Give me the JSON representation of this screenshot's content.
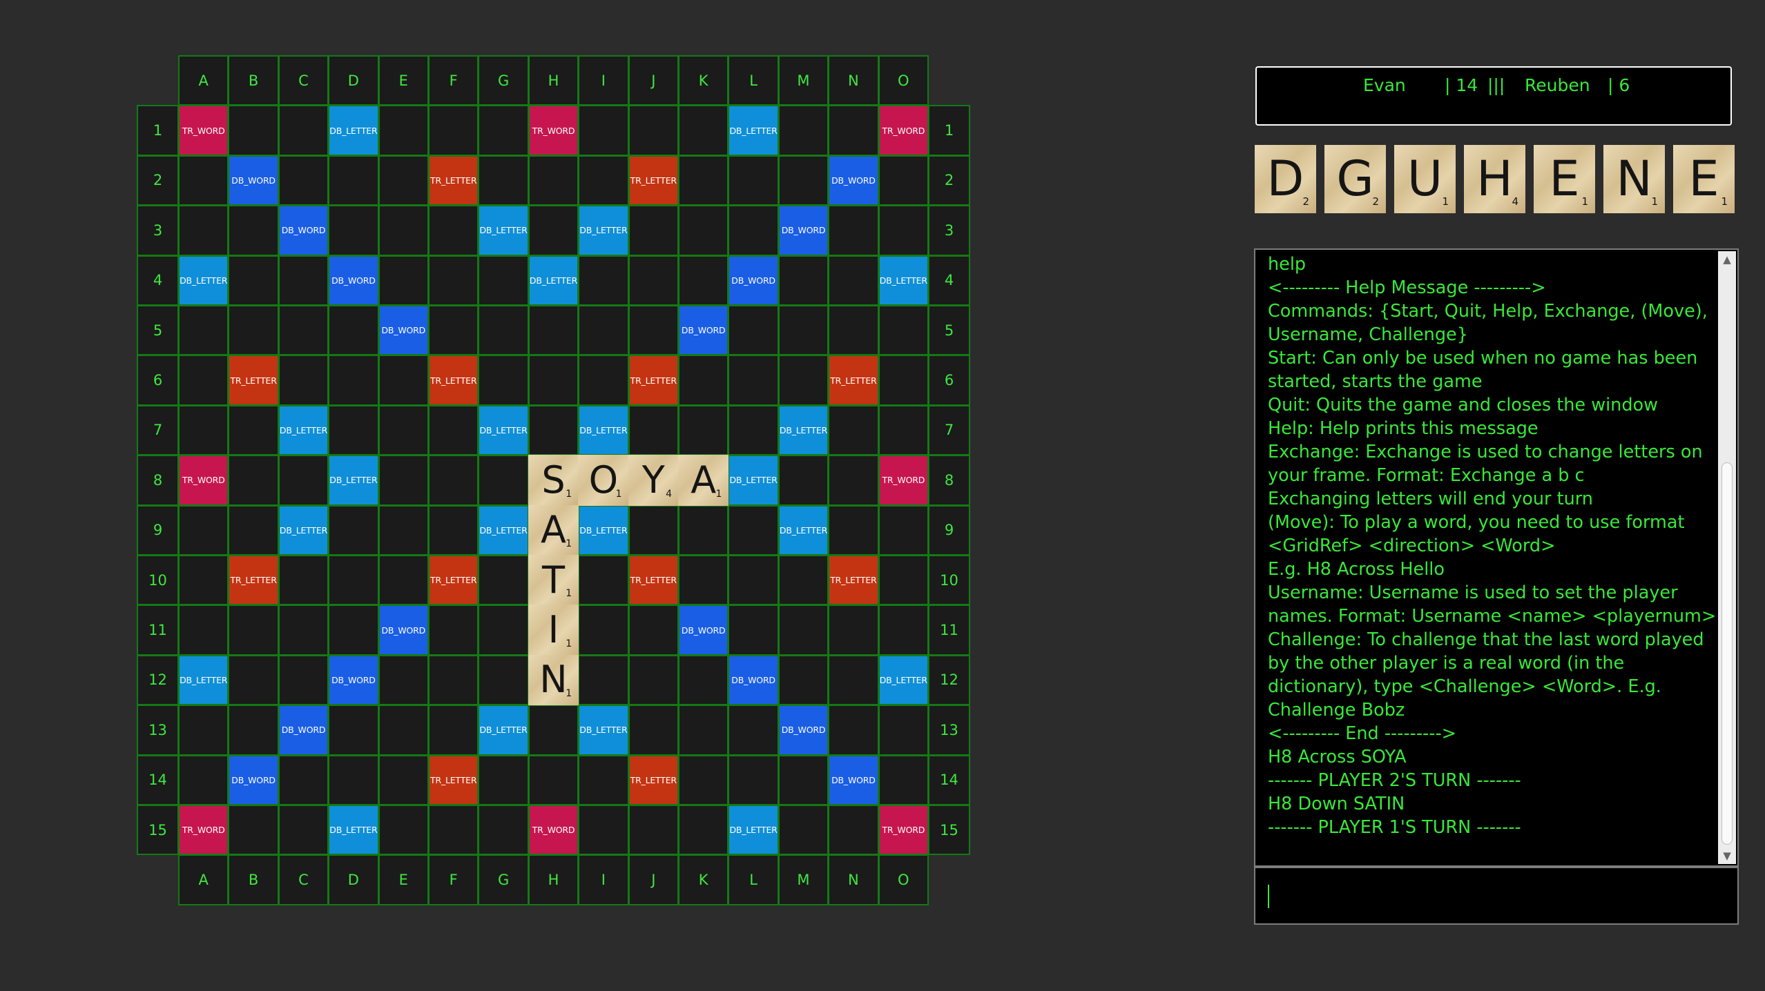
{
  "board": {
    "columns": [
      "A",
      "B",
      "C",
      "D",
      "E",
      "F",
      "G",
      "H",
      "I",
      "J",
      "K",
      "L",
      "M",
      "N",
      "O"
    ],
    "rows": [
      "1",
      "2",
      "3",
      "4",
      "5",
      "6",
      "7",
      "8",
      "9",
      "10",
      "11",
      "12",
      "13",
      "14",
      "15"
    ],
    "colors": {
      "TR_WORD": "#c7164f",
      "DB_WORD": "#1a5ee6",
      "DB_LETTER": "#0f8fd9",
      "TR_LETTER": "#c53412"
    },
    "premium_rows": [
      [
        "TR_WORD",
        "",
        "",
        "DB_LETTER",
        "",
        "",
        "",
        "TR_WORD",
        "",
        "",
        "",
        "DB_LETTER",
        "",
        "",
        "TR_WORD"
      ],
      [
        "",
        "DB_WORD",
        "",
        "",
        "",
        "TR_LETTER",
        "",
        "",
        "",
        "TR_LETTER",
        "",
        "",
        "",
        "DB_WORD",
        ""
      ],
      [
        "",
        "",
        "DB_WORD",
        "",
        "",
        "",
        "DB_LETTER",
        "",
        "DB_LETTER",
        "",
        "",
        "",
        "DB_WORD",
        "",
        ""
      ],
      [
        "DB_LETTER",
        "",
        "",
        "DB_WORD",
        "",
        "",
        "",
        "DB_LETTER",
        "",
        "",
        "",
        "DB_WORD",
        "",
        "",
        "DB_LETTER"
      ],
      [
        "",
        "",
        "",
        "",
        "DB_WORD",
        "",
        "",
        "",
        "",
        "",
        "DB_WORD",
        "",
        "",
        "",
        ""
      ],
      [
        "",
        "TR_LETTER",
        "",
        "",
        "",
        "TR_LETTER",
        "",
        "",
        "",
        "TR_LETTER",
        "",
        "",
        "",
        "TR_LETTER",
        ""
      ],
      [
        "",
        "",
        "DB_LETTER",
        "",
        "",
        "",
        "DB_LETTER",
        "",
        "DB_LETTER",
        "",
        "",
        "",
        "DB_LETTER",
        "",
        ""
      ],
      [
        "TR_WORD",
        "",
        "",
        "DB_LETTER",
        "",
        "",
        "",
        "",
        "",
        "",
        "",
        "DB_LETTER",
        "",
        "",
        "TR_WORD"
      ],
      [
        "",
        "",
        "DB_LETTER",
        "",
        "",
        "",
        "DB_LETTER",
        "",
        "DB_LETTER",
        "",
        "",
        "",
        "DB_LETTER",
        "",
        ""
      ],
      [
        "",
        "TR_LETTER",
        "",
        "",
        "",
        "TR_LETTER",
        "",
        "",
        "",
        "TR_LETTER",
        "",
        "",
        "",
        "TR_LETTER",
        ""
      ],
      [
        "",
        "",
        "",
        "",
        "DB_WORD",
        "",
        "",
        "",
        "",
        "",
        "DB_WORD",
        "",
        "",
        "",
        ""
      ],
      [
        "DB_LETTER",
        "",
        "",
        "DB_WORD",
        "",
        "",
        "",
        "",
        "",
        "",
        "",
        "DB_WORD",
        "",
        "",
        "DB_LETTER"
      ],
      [
        "",
        "",
        "DB_WORD",
        "",
        "",
        "",
        "DB_LETTER",
        "",
        "DB_LETTER",
        "",
        "",
        "",
        "DB_WORD",
        "",
        ""
      ],
      [
        "",
        "DB_WORD",
        "",
        "",
        "",
        "TR_LETTER",
        "",
        "",
        "",
        "TR_LETTER",
        "",
        "",
        "",
        "DB_WORD",
        ""
      ],
      [
        "TR_WORD",
        "",
        "",
        "DB_LETTER",
        "",
        "",
        "",
        "TR_WORD",
        "",
        "",
        "",
        "DB_LETTER",
        "",
        "",
        "TR_WORD"
      ]
    ],
    "placed_tiles": [
      {
        "cell": "H8",
        "letter": "S",
        "points": "1"
      },
      {
        "cell": "I8",
        "letter": "O",
        "points": "1"
      },
      {
        "cell": "J8",
        "letter": "Y",
        "points": "4"
      },
      {
        "cell": "K8",
        "letter": "A",
        "points": "1"
      },
      {
        "cell": "H9",
        "letter": "A",
        "points": "1"
      },
      {
        "cell": "H10",
        "letter": "T",
        "points": "1"
      },
      {
        "cell": "H11",
        "letter": "I",
        "points": "1"
      },
      {
        "cell": "H12",
        "letter": "N",
        "points": "1"
      }
    ]
  },
  "scoreboard": {
    "player1_name": "Evan",
    "player1_score": "| 14",
    "separator": "|||",
    "player2_name": "Reuben",
    "player2_score": "| 6"
  },
  "rack": [
    {
      "letter": "D",
      "points": "2"
    },
    {
      "letter": "G",
      "points": "2"
    },
    {
      "letter": "U",
      "points": "1"
    },
    {
      "letter": "H",
      "points": "4"
    },
    {
      "letter": "E",
      "points": "1"
    },
    {
      "letter": "N",
      "points": "1"
    },
    {
      "letter": "E",
      "points": "1"
    }
  ],
  "console": {
    "lines": [
      "help",
      "<--------- Help Message --------->",
      "Commands: {Start, Quit, Help, Exchange, (Move), Username, Challenge}",
      "Start: Can only be used when no game has been started, starts the game",
      "Quit: Quits the game and closes the window",
      "Help: Help prints this message",
      "Exchange: Exchange is used to change letters on your frame. Format: Exchange a b c",
      "Exchanging letters will end your turn",
      "(Move): To play a word, you need to use format <GridRef> <direction> <Word>",
      "E.g. H8 Across Hello",
      "Username: Username is used to set the player names. Format: Username <name> <playernum>",
      "Challenge: To challenge that the last word played by the other player is a real word (in the dictionary), type <Challenge> <Word>. E.g. Challenge Bobz",
      "<--------- End --------->",
      "H8 Across SOYA",
      "------- PLAYER 2'S TURN -------",
      "H8 Down SATIN",
      "------- PLAYER 1'S TURN -------"
    ],
    "scroll_up_icon": "triangle-up",
    "scroll_down_icon": "triangle-down"
  },
  "command_input": {
    "value": ""
  }
}
